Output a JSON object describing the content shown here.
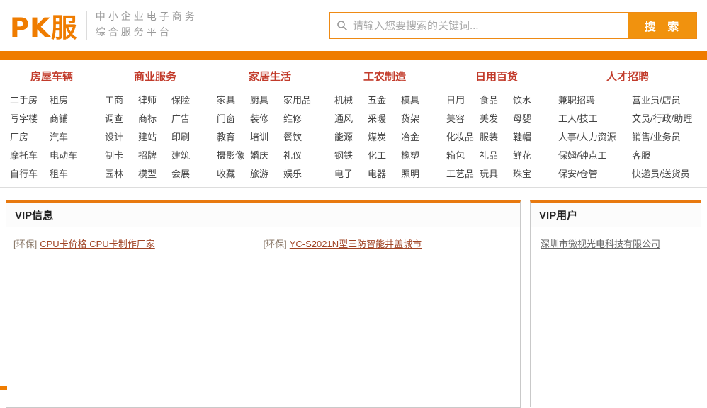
{
  "colors": {
    "accent_orange": "#ef7c00",
    "button_orange": "#f1920e",
    "category_red": "#c23b2b",
    "nav_link": "#444444",
    "vip_link": "#a14425",
    "vip_prefix": "#8c7b6b",
    "vip_user_link": "#666666"
  },
  "header": {
    "logo_text": "PK服",
    "tagline_line1": "中小企业电子商务",
    "tagline_line2": "综合服务平台",
    "search": {
      "placeholder": "请输入您要搜索的关键词...",
      "button_label": "搜 索",
      "icon": "magnifier"
    }
  },
  "nav": {
    "categories": [
      {
        "title": "房屋车辆",
        "items": [
          "二手房",
          "租房",
          "写字楼",
          "商铺",
          "厂房",
          "汽车",
          "摩托车",
          "电动车",
          "自行车",
          "租车"
        ]
      },
      {
        "title": "商业服务",
        "items": [
          "工商",
          "律师",
          "保险",
          "调查",
          "商标",
          "广告",
          "设计",
          "建站",
          "印刷",
          "制卡",
          "招牌",
          "建筑",
          "园林",
          "模型",
          "会展"
        ]
      },
      {
        "title": "家居生活",
        "items": [
          "家具",
          "厨具",
          "家用品",
          "门窗",
          "装修",
          "维修",
          "教育",
          "培训",
          "餐饮",
          "摄影像",
          "婚庆",
          "礼仪",
          "收藏",
          "旅游",
          "娱乐"
        ]
      },
      {
        "title": "工农制造",
        "items": [
          "机械",
          "五金",
          "模具",
          "通风",
          "采暖",
          "货架",
          "能源",
          "煤炭",
          "冶金",
          "钢铁",
          "化工",
          "橡塑",
          "电子",
          "电器",
          "照明"
        ]
      },
      {
        "title": "日用百货",
        "items": [
          "日用",
          "食品",
          "饮水",
          "美容",
          "美发",
          "母婴",
          "化妆品",
          "服装",
          "鞋帽",
          "箱包",
          "礼品",
          "鲜花",
          "工艺品",
          "玩具",
          "珠宝"
        ]
      },
      {
        "title": "人才招聘",
        "items": [
          "兼职招聘",
          "营业员/店员",
          "工人/技工",
          "文员/行政/助理",
          "人事/人力资源",
          "销售/业务员",
          "保姆/钟点工",
          "客服",
          "保安/仓管",
          "快递员/送货员"
        ]
      }
    ]
  },
  "vip_info": {
    "title": "VIP信息",
    "items": [
      {
        "prefix": "[环保]",
        "label": "CPU卡价格 CPU卡制作厂家"
      },
      {
        "prefix": "[环保]",
        "label": "YC-S2021N型三防智能井盖城市"
      }
    ]
  },
  "vip_users": {
    "title": "VIP用户",
    "items": [
      {
        "label": "深圳市微视光电科技有限公司"
      }
    ]
  }
}
